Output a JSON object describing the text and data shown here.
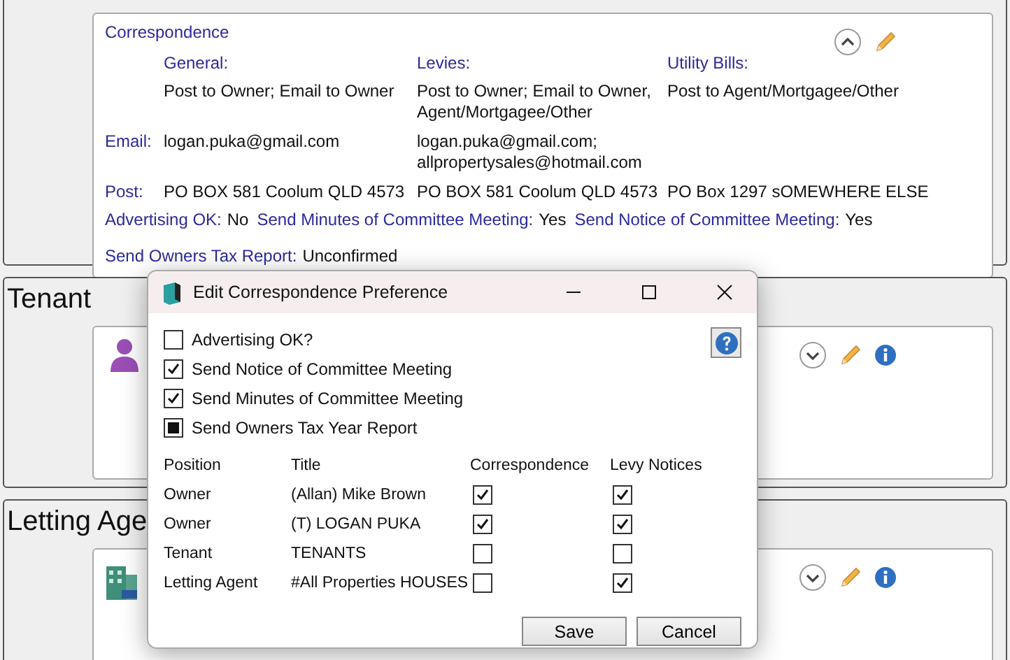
{
  "correspondence_card": {
    "title": "Correspondence",
    "columns": [
      "General:",
      "Levies:",
      "Utility Bills:"
    ],
    "methods": [
      "Post to Owner; Email to Owner",
      "Post to Owner; Email to Owner, Agent/Mortgagee/Other",
      "Post to Agent/Mortgagee/Other"
    ],
    "email_label": "Email:",
    "emails": [
      "logan.puka@gmail.com",
      "logan.puka@gmail.com; allpropertysales@hotmail.com"
    ],
    "post_label": "Post:",
    "posts": [
      "PO BOX 581 Coolum QLD 4573",
      "PO BOX 581 Coolum QLD 4573",
      "PO Box 1297 sOMEWHERE ELSE"
    ],
    "flags": [
      {
        "label": "Advertising OK:",
        "value": "No"
      },
      {
        "label": "Send Minutes of Committee Meeting:",
        "value": "Yes"
      },
      {
        "label": "Send Notice of Committee Meeting:",
        "value": "Yes"
      },
      {
        "label": "Send Owners Tax Report:",
        "value": "Unconfirmed"
      }
    ],
    "expanded": true
  },
  "tenant_section": {
    "title": "Tenant",
    "expanded": false
  },
  "letting_agent_section": {
    "title": "Letting Age",
    "expanded": false
  },
  "dialog": {
    "title": "Edit Correspondence Preference",
    "options": [
      {
        "label": "Advertising OK?",
        "checked": false,
        "indeterminate": false
      },
      {
        "label": "Send Notice of Committee Meeting",
        "checked": true,
        "indeterminate": false
      },
      {
        "label": "Send Minutes of Committee Meeting",
        "checked": true,
        "indeterminate": false
      },
      {
        "label": "Send Owners Tax Year Report",
        "indeterminate": true
      }
    ],
    "columns": [
      "Position",
      "Title",
      "Correspondence",
      "Levy Notices"
    ],
    "rows": [
      {
        "position": "Owner",
        "title": "(Allan) Mike Brown",
        "correspondence": true,
        "levy_notices": true
      },
      {
        "position": "Owner",
        "title": "(T) LOGAN PUKA",
        "correspondence": true,
        "levy_notices": true
      },
      {
        "position": "Tenant",
        "title": "TENANTS",
        "correspondence": false,
        "levy_notices": false
      },
      {
        "position": "Letting Agent",
        "title": "#All Properties HOUSES",
        "correspondence": false,
        "levy_notices": true
      }
    ],
    "buttons": [
      "Save",
      "Cancel"
    ]
  }
}
